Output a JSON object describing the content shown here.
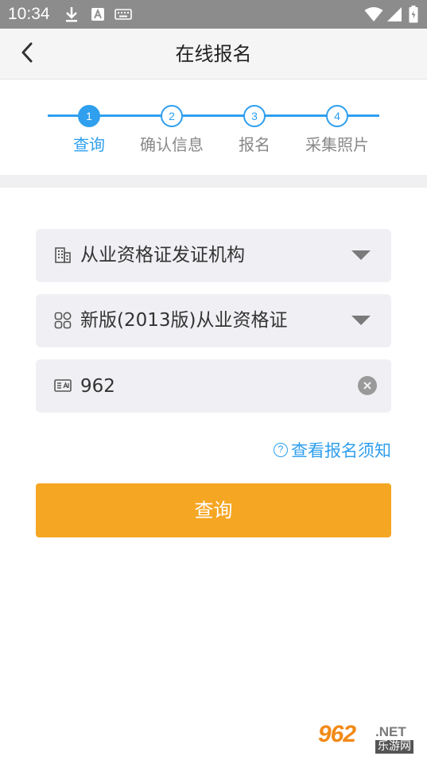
{
  "status_bar": {
    "time": "10:34",
    "icons": [
      "download-icon",
      "a-badge-icon",
      "keyboard-icon",
      "wifi-icon",
      "signal-icon",
      "battery-icon"
    ]
  },
  "header": {
    "title": "在线报名",
    "back_icon": "chevron-left-icon"
  },
  "steps": [
    {
      "number": "1",
      "label": "查询",
      "active": true
    },
    {
      "number": "2",
      "label": "确认信息",
      "active": false
    },
    {
      "number": "3",
      "label": "报名",
      "active": false
    },
    {
      "number": "4",
      "label": "采集照片",
      "active": false
    }
  ],
  "form": {
    "issuer_select": {
      "value": "从业资格证发证机构",
      "icon": "building-icon"
    },
    "version_select": {
      "value": "新版(2013版)从业资格证",
      "icon": "grid-icon"
    },
    "id_input": {
      "value": "962",
      "icon": "id-card-icon",
      "clear_icon": "clear-circle-icon"
    }
  },
  "notice_link": {
    "label": "查看报名须知",
    "icon": "question-circle-icon"
  },
  "query_button": {
    "label": "查询"
  },
  "watermark": {
    "number": "962",
    "domain": ".NET",
    "site_name": "乐游网"
  },
  "colors": {
    "accent_blue": "#2f9fee",
    "button_orange": "#f5a623",
    "status_bar": "#8c8c8c",
    "field_bg": "#f0f0f4"
  }
}
